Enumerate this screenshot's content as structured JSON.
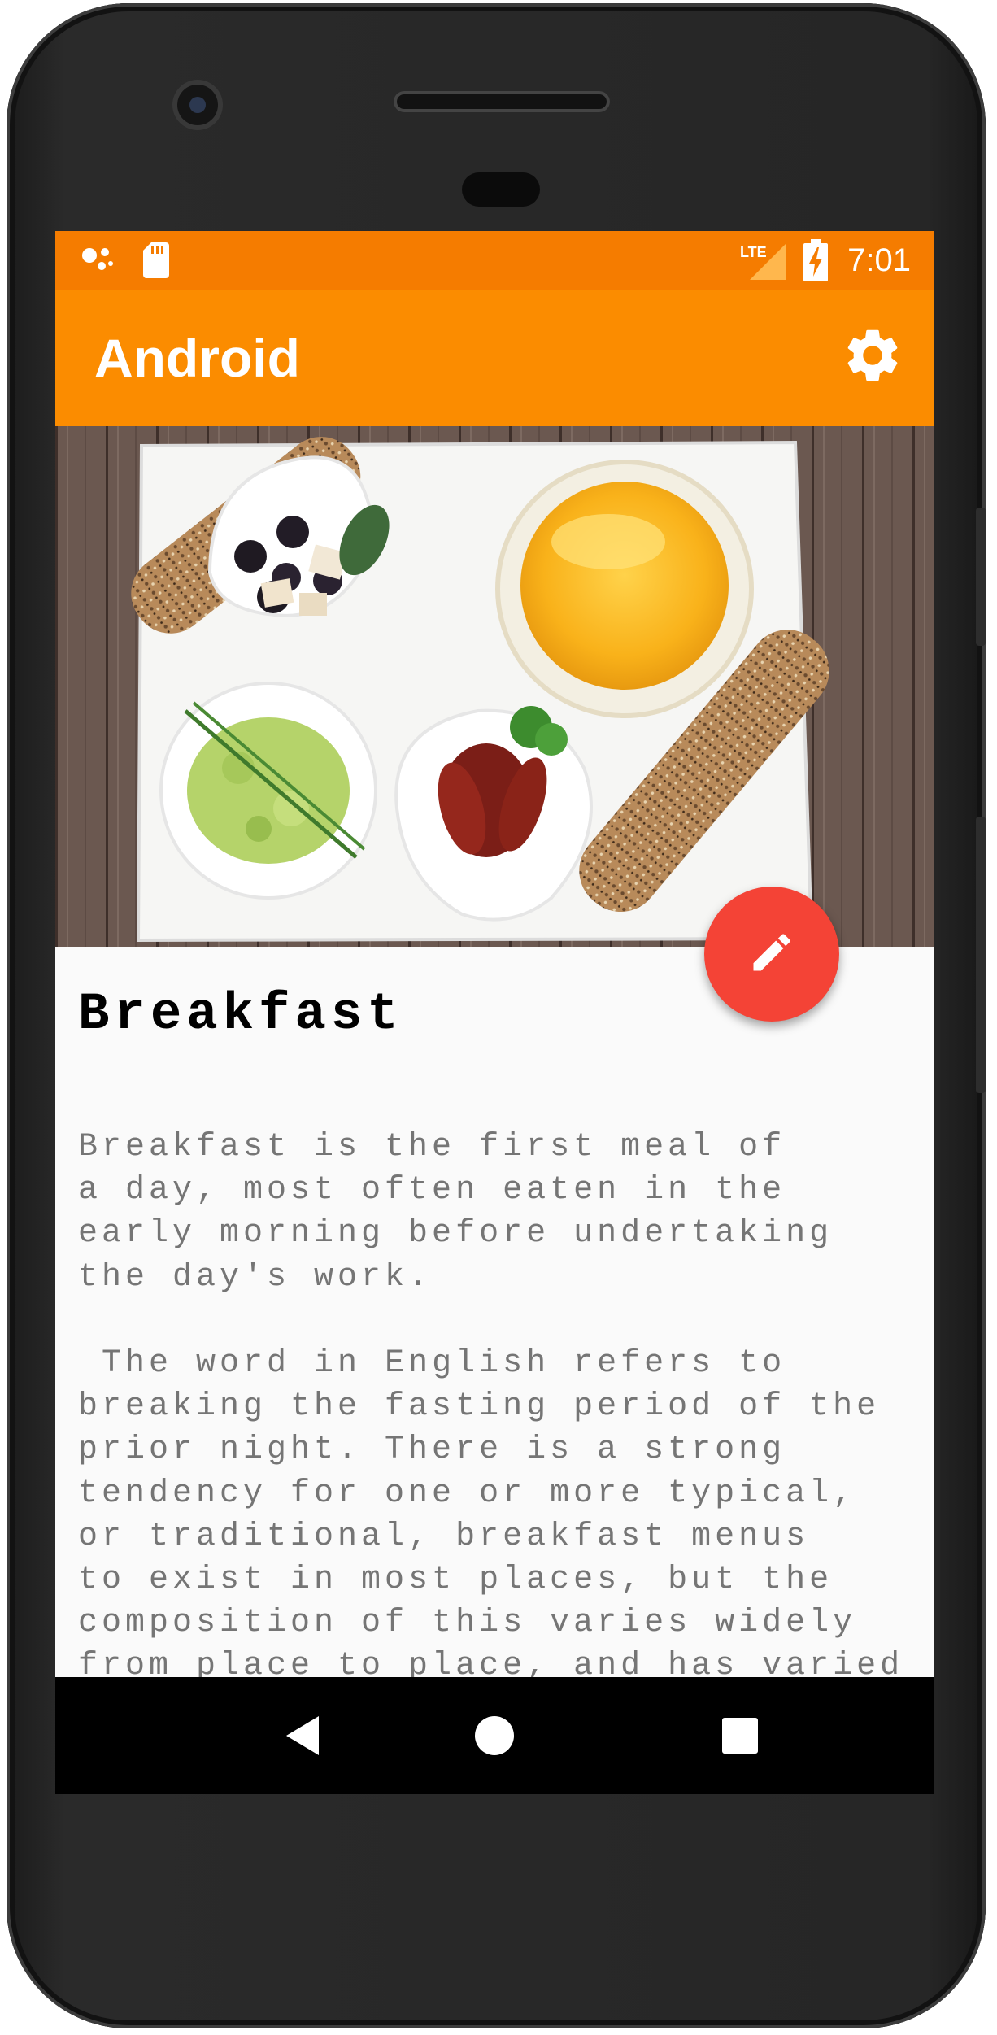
{
  "status_bar": {
    "time": "7:01",
    "network_label": "LTE",
    "icons": [
      "assistant-dots-icon",
      "sd-card-icon",
      "lte-signal-icon",
      "battery-charging-icon"
    ]
  },
  "app_bar": {
    "title": "Android",
    "settings_icon": "gear-icon"
  },
  "hero": {
    "description": "breakfast-plate-photo"
  },
  "fab": {
    "icon": "pencil-icon",
    "color": "#f44336"
  },
  "content": {
    "title": "Breakfast",
    "paragraphs": [
      "Breakfast is the first meal of\na day, most often eaten in the\nearly morning before undertaking\nthe day's work.",
      " The word in English refers to\nbreaking the fasting period of the\nprior night. There is a strong\ntendency for one or more typical,\nor traditional, breakfast menus\nto exist in most places, but the\ncomposition of this varies widely\nfrom place to place, and has varied"
    ]
  },
  "nav_bar": {
    "back_icon": "back-triangle-icon",
    "home_icon": "home-circle-icon",
    "recents_icon": "recents-square-icon"
  },
  "colors": {
    "status_bar": "#f57c00",
    "app_bar": "#fb8c00",
    "fab": "#f44336",
    "body_text": "#757575"
  }
}
